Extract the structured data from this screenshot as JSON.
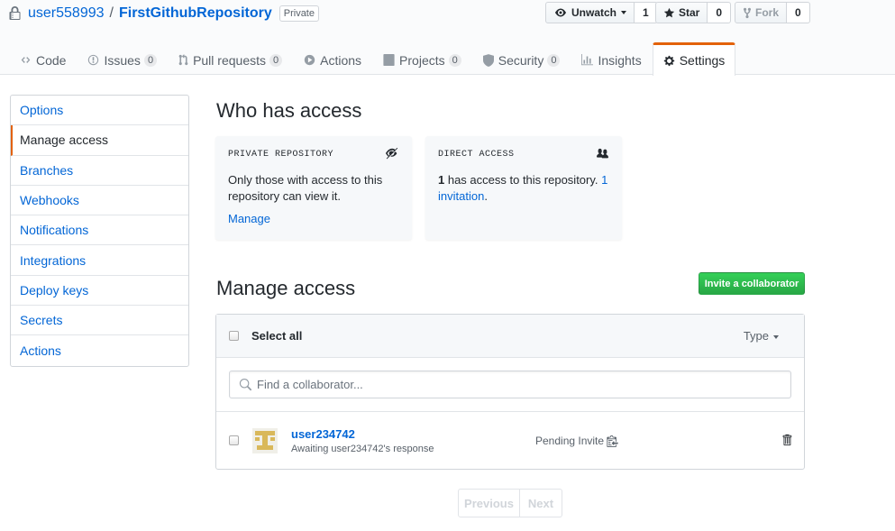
{
  "repo": {
    "owner": "user558993",
    "separator": "/",
    "name": "FirstGithubRepository",
    "visibility": "Private"
  },
  "actions": {
    "unwatch_label": "Unwatch",
    "unwatch_count": "1",
    "star_label": "Star",
    "star_count": "0",
    "fork_label": "Fork",
    "fork_count": "0"
  },
  "nav": {
    "code": "Code",
    "issues": "Issues",
    "issues_count": "0",
    "pulls": "Pull requests",
    "pulls_count": "0",
    "actions": "Actions",
    "projects": "Projects",
    "projects_count": "0",
    "security": "Security",
    "security_count": "0",
    "insights": "Insights",
    "settings": "Settings"
  },
  "sidebar": {
    "items": [
      {
        "label": "Options"
      },
      {
        "label": "Manage access"
      },
      {
        "label": "Branches"
      },
      {
        "label": "Webhooks"
      },
      {
        "label": "Notifications"
      },
      {
        "label": "Integrations"
      },
      {
        "label": "Deploy keys"
      },
      {
        "label": "Secrets"
      },
      {
        "label": "Actions"
      }
    ]
  },
  "who": {
    "heading": "Who has access",
    "private_box": {
      "title": "Private repository",
      "text": "Only those with access to this repository can view it.",
      "link": "Manage"
    },
    "direct_box": {
      "title": "Direct access",
      "count": "1",
      "text": " has access to this repository. ",
      "link": "1 invitation",
      "suffix": "."
    }
  },
  "manage": {
    "heading": "Manage access",
    "invite_button": "Invite a collaborator",
    "select_all": "Select all",
    "type_label": "Type",
    "search_placeholder": "Find a collaborator...",
    "members": [
      {
        "login": "user234742",
        "status": "Awaiting user234742's response",
        "state": "Pending Invite"
      }
    ]
  },
  "pagination": {
    "previous": "Previous",
    "next": "Next"
  },
  "colors": {
    "link": "#0366d6",
    "accent": "#e36209",
    "primary": "#28a745"
  }
}
